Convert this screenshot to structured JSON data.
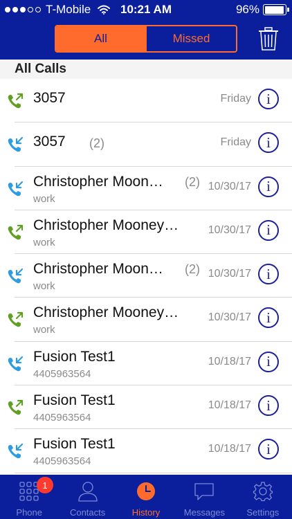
{
  "status_bar": {
    "carrier": "T-Mobile",
    "time": "10:21 AM",
    "battery": "96%",
    "battery_level": 0.96
  },
  "segment": {
    "all_label": "All",
    "missed_label": "Missed"
  },
  "section": {
    "title": "All Calls"
  },
  "calls": [
    {
      "direction": "outgoing",
      "name": "3057",
      "count": "",
      "sub": "",
      "date": "Friday"
    },
    {
      "direction": "incoming",
      "name": "3057",
      "count": "(2)",
      "sub": "",
      "date": "Friday"
    },
    {
      "direction": "incoming",
      "name": "Christopher Moon…",
      "count": "(2)",
      "sub": "work",
      "date": "10/30/17"
    },
    {
      "direction": "outgoing",
      "name": "Christopher Mooney…",
      "count": "",
      "sub": "work",
      "date": "10/30/17"
    },
    {
      "direction": "incoming",
      "name": "Christopher Moon…",
      "count": "(2)",
      "sub": "work",
      "date": "10/30/17"
    },
    {
      "direction": "outgoing",
      "name": "Christopher Mooney…",
      "count": "",
      "sub": "work",
      "date": "10/30/17"
    },
    {
      "direction": "incoming",
      "name": "Fusion Test1",
      "count": "",
      "sub": "4405963564",
      "date": "10/18/17"
    },
    {
      "direction": "outgoing",
      "name": "Fusion Test1",
      "count": "",
      "sub": "4405963564",
      "date": "10/18/17"
    },
    {
      "direction": "incoming",
      "name": "Fusion Test1",
      "count": "",
      "sub": "4405963564",
      "date": "10/18/17"
    }
  ],
  "info_glyph": "i",
  "tabs": {
    "phone": "Phone",
    "phone_badge": "1",
    "contacts": "Contacts",
    "history": "History",
    "messages": "Messages",
    "settings": "Settings"
  },
  "colors": {
    "brand_blue": "#0b1f9c",
    "accent_orange": "#ff6b2c",
    "outgoing_green": "#5fa022",
    "incoming_blue": "#2f9be0"
  }
}
